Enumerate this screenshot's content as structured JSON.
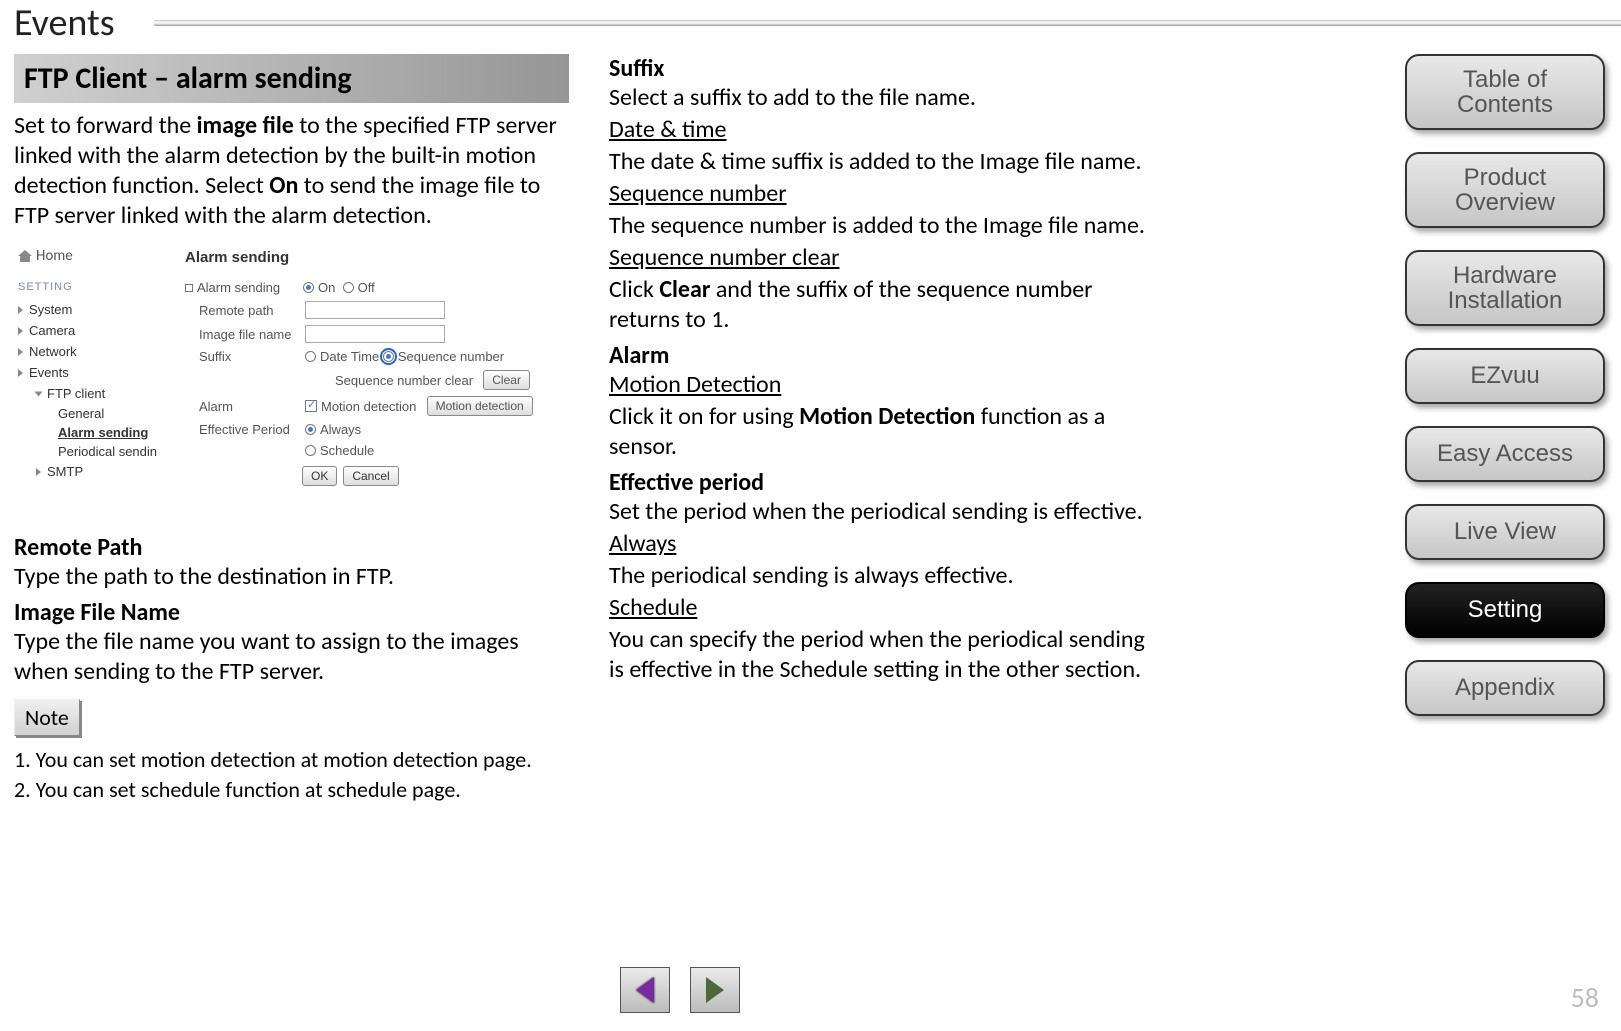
{
  "page_title": "Events",
  "page_number": "58",
  "left": {
    "section_title": "FTP Client – alarm sending",
    "intro_a": "Set to forward the",
    "intro_bold1": "image file",
    "intro_b": "to the specified FTP server linked with the alarm detection by the built-in motion detection function. Select",
    "intro_bold2": "On",
    "intro_c": "to send the image file to FTP server linked with the alarm detection.",
    "remote_path_h": "Remote Path",
    "remote_path_p": "Type the path to the destination in FTP.",
    "ifn_h": "Image File Name",
    "ifn_p": "Type the file name you want to assign to the images when sending to the FTP server.",
    "note_label": "Note",
    "note1": "1. You can set motion detection at motion detection page.",
    "note2": "2. You can set schedule function at schedule page."
  },
  "screenshot": {
    "home": "Home",
    "setting": "SETTING",
    "nav": {
      "system": "System",
      "camera": "Camera",
      "network": "Network",
      "events": "Events",
      "ftp": "FTP client",
      "general": "General",
      "alarm": "Alarm sending",
      "periodical": "Periodical sendin",
      "smtp": "SMTP"
    },
    "panel_title": "Alarm sending",
    "rows": {
      "alarm_sending": "Alarm sending",
      "on": "On",
      "off": "Off",
      "remote_path": "Remote path",
      "image_file_name": "Image file name",
      "suffix": "Suffix",
      "datetime": "Date Time",
      "seq": "Sequence number",
      "seq_clear": "Sequence number clear",
      "clear": "Clear",
      "alarm": "Alarm",
      "motion_det": "Motion detection",
      "motion_btn": "Motion detection",
      "effective": "Effective Period",
      "always": "Always",
      "schedule": "Schedule",
      "ok": "OK",
      "cancel": "Cancel"
    }
  },
  "right": {
    "suffix_h": "Suffix",
    "suffix_p": "Select a suffix to add to the file name.",
    "dt_h": "Date & time",
    "dt_p": "The date & time suffix is added to the Image file name.",
    "seq_h": "Sequence number",
    "seq_p": "The sequence number is added to the Image file name.",
    "seqc_h": "Sequence number clear",
    "seqc_a": "Click",
    "seqc_bold": "Clear",
    "seqc_b": "and the suffix of the sequence number returns to 1.",
    "alarm_h": "Alarm",
    "md_h": " Motion Detection",
    "md_a": "Click it on for using",
    "md_bold": "Motion Detection",
    "md_b": "function as a sensor.",
    "ep_h": "Effective period",
    "ep_p": "Set the period when the periodical sending is effective.",
    "always_h": "Always",
    "always_p": "The periodical sending is always effective.",
    "sched_h": "Schedule",
    "sched_p": "You can specify the period when the periodical sending is effective in the Schedule setting in the other section."
  },
  "nav": {
    "toc": "Table of Contents",
    "product": "Product Overview",
    "hardware": "Hardware Installation",
    "ezvuu": "EZvuu",
    "easy": "Easy Access",
    "live": "Live View",
    "setting": "Setting",
    "appendix": "Appendix"
  }
}
